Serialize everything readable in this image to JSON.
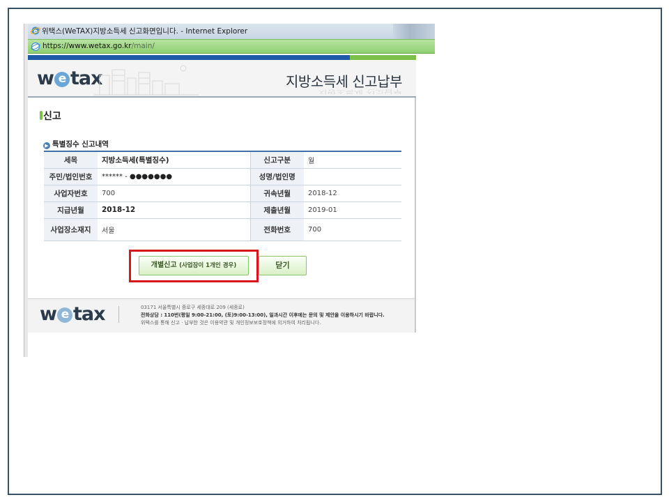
{
  "browser": {
    "window_title": "위택스(WeTAX)지방소득세 신고화면입니다. - Internet Explorer",
    "url_prefix": "https://",
    "url_host": "www.wetax.go.kr",
    "url_path": "/main/"
  },
  "site": {
    "logo_left": "w",
    "logo_e": "e",
    "logo_right": "tax",
    "service_title": "지방소득세 신고납부"
  },
  "page": {
    "section_title": "신고",
    "sub_title": "특별징수 신고내역"
  },
  "table": {
    "rows": [
      {
        "label1": "세목",
        "value1": "지방소득세(특별징수)",
        "label2": "신고구분",
        "value2": "월"
      },
      {
        "label1": "주민/법인번호",
        "value1": "****** - ●●●●●●●",
        "label2": "성명/법인명",
        "value2": ""
      },
      {
        "label1": "사업자번호",
        "value1": "700",
        "label2": "귀속년월",
        "value2": "2018-12"
      },
      {
        "label1": "지급년월",
        "value1": "2018-12",
        "label2": "제출년월",
        "value2": "2019-01"
      },
      {
        "label1": "사업장소재지",
        "value1": "서울",
        "label2": "전화번호",
        "value2": "700"
      }
    ]
  },
  "buttons": {
    "individual_main": "개별신고 ",
    "individual_sub": "(사업장이 1개인 경우)",
    "close": "닫기"
  },
  "footer": {
    "address": "03171 서울특별시 종로구 세종대로 209 (세종로)",
    "phone": "전화상담 : 110번(평일 9:00-21:00, (토)9:00-13:00), 일과시간 이후에는 문의 및 제안을 이용하시기 바랍니다.",
    "notice": "위택스를 통해 신고 · 납부한 것은 이용약관 및 개인정보보호정책에 의거하여 처리됩니다."
  },
  "colors": {
    "header_blue": "#1e5aa6",
    "header_green": "#7cc04b",
    "highlight_red": "#d9161c",
    "frame": "#3a5066"
  }
}
